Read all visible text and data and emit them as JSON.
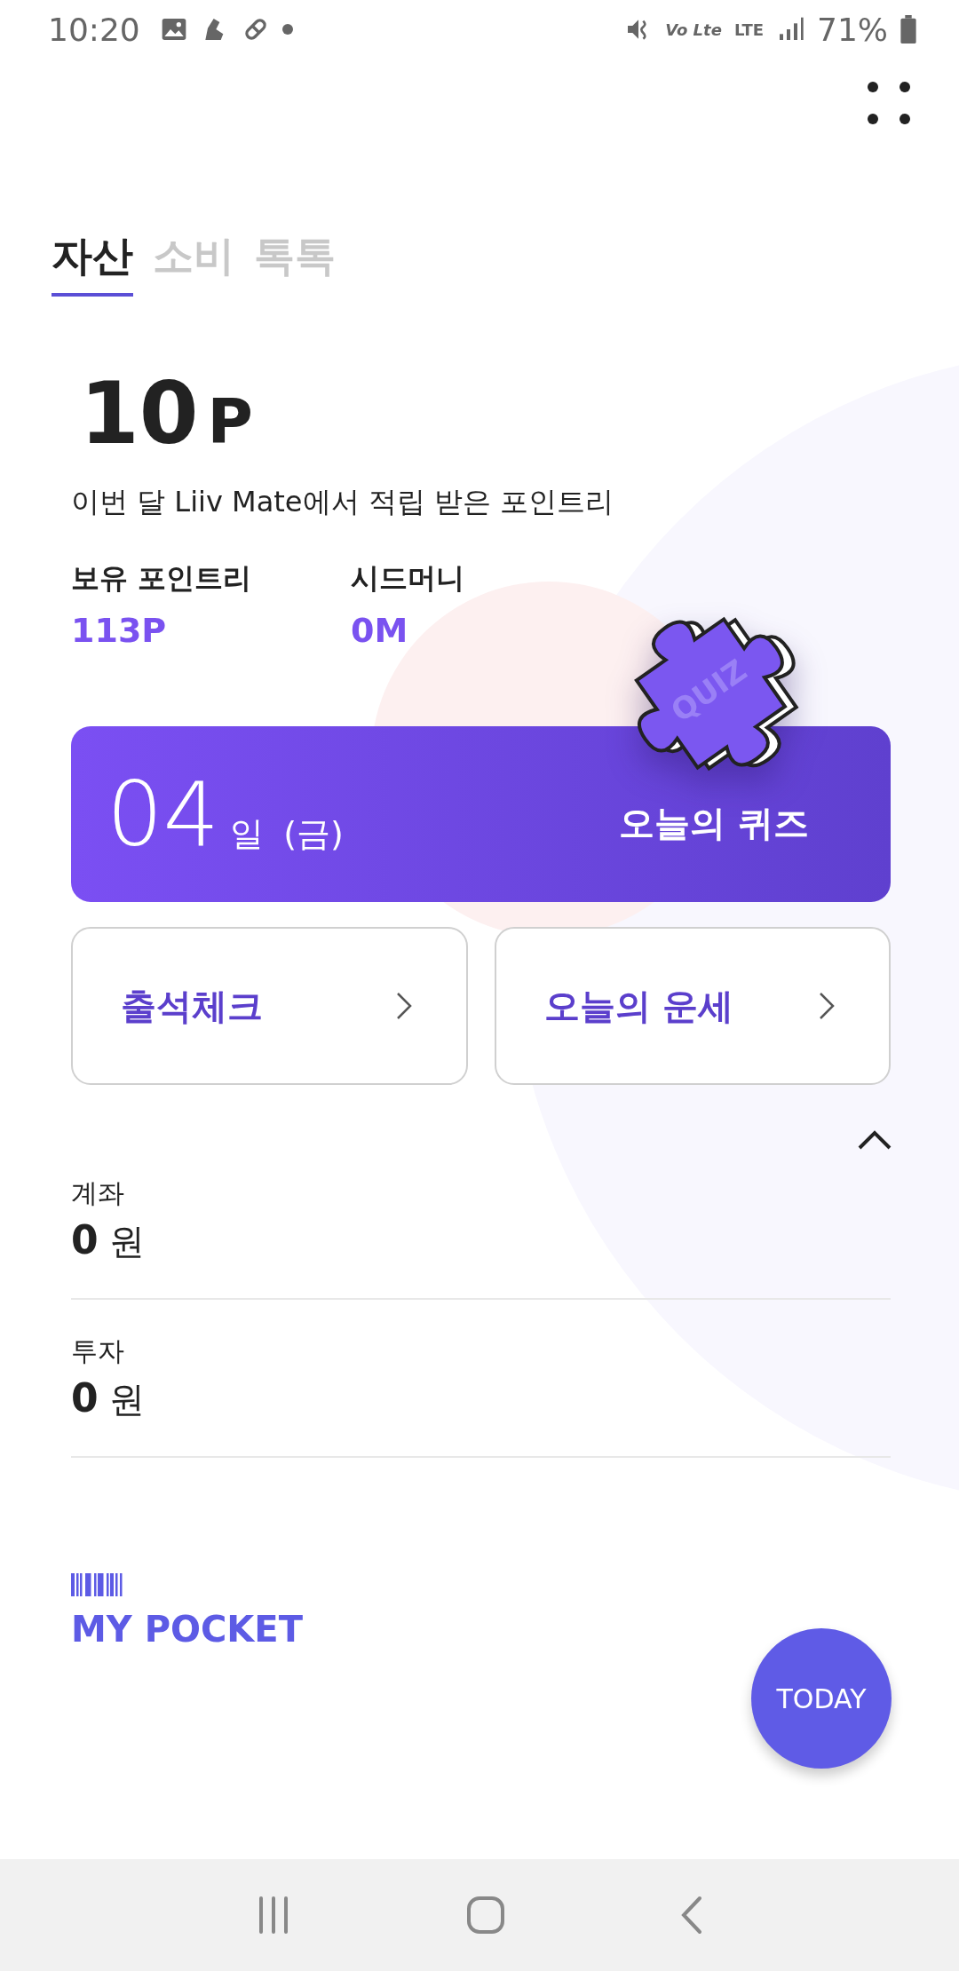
{
  "status_bar": {
    "time": "10:20",
    "volte": "Vo Lte",
    "network": "LTE",
    "battery": "71%"
  },
  "tabs": [
    {
      "label": "자산",
      "selected": true
    },
    {
      "label": "소비",
      "selected": false
    },
    {
      "label": "톡톡",
      "selected": false
    }
  ],
  "points": {
    "value": "10",
    "unit": "P",
    "caption": "이번 달 Liiv Mate에서 적립 받은 포인트리"
  },
  "stats": [
    {
      "label": "보유 포인트리",
      "value": "113P"
    },
    {
      "label": "시드머니",
      "value": "0M"
    }
  ],
  "quiz": {
    "badge": "QUIZ",
    "day": "04",
    "day_unit": "일",
    "weekday": "(금)",
    "title": "오늘의 퀴즈"
  },
  "actions": [
    {
      "label": "출석체크"
    },
    {
      "label": "오늘의 운세"
    }
  ],
  "assets_expanded": true,
  "assets": [
    {
      "label": "계좌",
      "amount": "0",
      "unit": "원"
    },
    {
      "label": "투자",
      "amount": "0",
      "unit": "원"
    }
  ],
  "pocket": {
    "title": "MY POCKET"
  },
  "fab": {
    "label": "TODAY"
  }
}
